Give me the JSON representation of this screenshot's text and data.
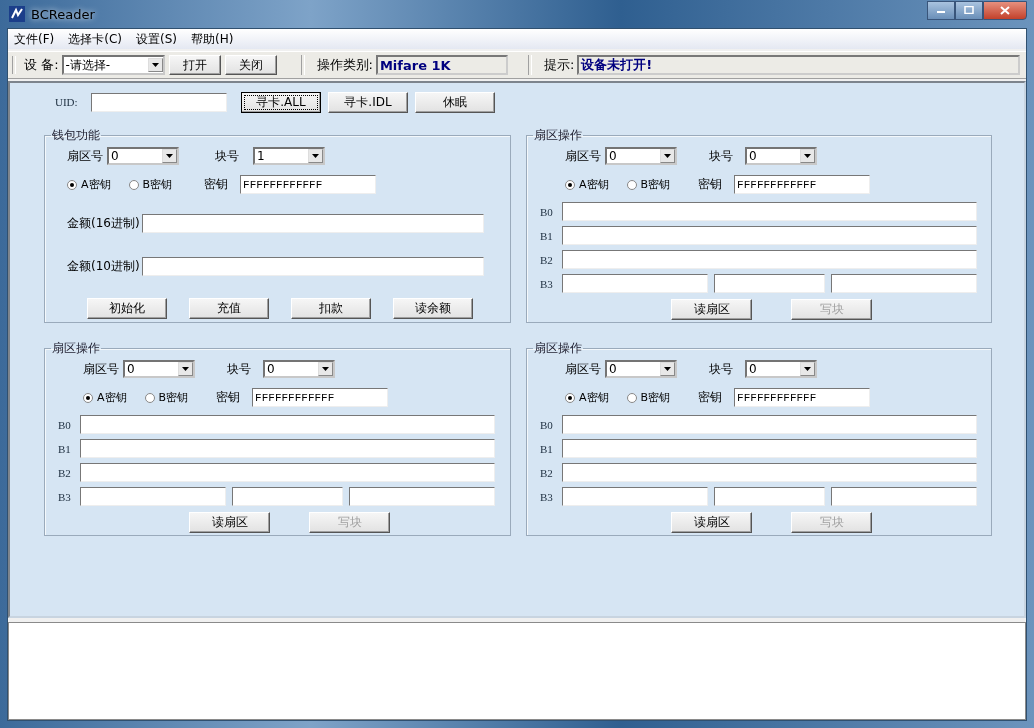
{
  "window": {
    "title": "BCReader"
  },
  "menu": [
    "文件(F)",
    "选择卡(C)",
    "设置(S)",
    "帮助(H)"
  ],
  "toolbar": {
    "device_label": "设 备:",
    "device_value": "-请选择-",
    "buttons": [
      "打开",
      "关闭"
    ],
    "type_label": "操作类别:",
    "type_value": "Mifare 1K",
    "hint_label": "提示:",
    "hint_value": "设备未打开!"
  },
  "uid": {
    "label": "UID:",
    "buttons": [
      {
        "label": "寻卡.ALL",
        "focused": true
      },
      {
        "label": "寻卡.IDL",
        "focused": false
      },
      {
        "label": "休眠",
        "focused": false
      }
    ]
  },
  "wallet": {
    "title": "钱包功能",
    "sector_label": "扇区号",
    "sector_value": "0",
    "block_label": "块号",
    "block_value": "1",
    "key_options": [
      {
        "label": "A密钥",
        "selected": true
      },
      {
        "label": "B密钥",
        "selected": false
      }
    ],
    "key_label": "密钥",
    "key_value": "FFFFFFFFFFFF",
    "amounts": [
      {
        "label": "金额(16进制)"
      },
      {
        "label": "金额(10进制)"
      }
    ],
    "buttons": [
      "初始化",
      "充值",
      "扣款",
      "读余额"
    ]
  },
  "sector_panels": [
    {
      "title": "扇区操作",
      "sector_label": "扇区号",
      "sector_value": "0",
      "block_label": "块号",
      "block_value": "0",
      "key_options": [
        {
          "label": "A密钥",
          "selected": true
        },
        {
          "label": "B密钥",
          "selected": false
        }
      ],
      "key_label": "密钥",
      "key_value": "FFFFFFFFFFFF",
      "blocks": [
        {
          "label": "B0",
          "kind": "full"
        },
        {
          "label": "B1",
          "kind": "full"
        },
        {
          "label": "B2",
          "kind": "full"
        },
        {
          "label": "B3",
          "kind": "split"
        }
      ],
      "buttons": [
        {
          "label": "读扇区",
          "disabled": false
        },
        {
          "label": "写块",
          "disabled": true
        }
      ]
    },
    {
      "title": "扇区操作",
      "sector_label": "扇区号",
      "sector_value": "0",
      "block_label": "块号",
      "block_value": "0",
      "key_options": [
        {
          "label": "A密钥",
          "selected": true
        },
        {
          "label": "B密钥",
          "selected": false
        }
      ],
      "key_label": "密钥",
      "key_value": "FFFFFFFFFFFF",
      "blocks": [
        {
          "label": "B0",
          "kind": "full"
        },
        {
          "label": "B1",
          "kind": "full"
        },
        {
          "label": "B2",
          "kind": "full"
        },
        {
          "label": "B3",
          "kind": "split"
        }
      ],
      "buttons": [
        {
          "label": "读扇区",
          "disabled": false
        },
        {
          "label": "写块",
          "disabled": true
        }
      ]
    },
    {
      "title": "扇区操作",
      "sector_label": "扇区号",
      "sector_value": "0",
      "block_label": "块号",
      "block_value": "0",
      "key_options": [
        {
          "label": "A密钥",
          "selected": true
        },
        {
          "label": "B密钥",
          "selected": false
        }
      ],
      "key_label": "密钥",
      "key_value": "FFFFFFFFFFFF",
      "blocks": [
        {
          "label": "B0",
          "kind": "full"
        },
        {
          "label": "B1",
          "kind": "full"
        },
        {
          "label": "B2",
          "kind": "full"
        },
        {
          "label": "B3",
          "kind": "split"
        }
      ],
      "buttons": [
        {
          "label": "读扇区",
          "disabled": false
        },
        {
          "label": "写块",
          "disabled": true
        }
      ]
    }
  ]
}
